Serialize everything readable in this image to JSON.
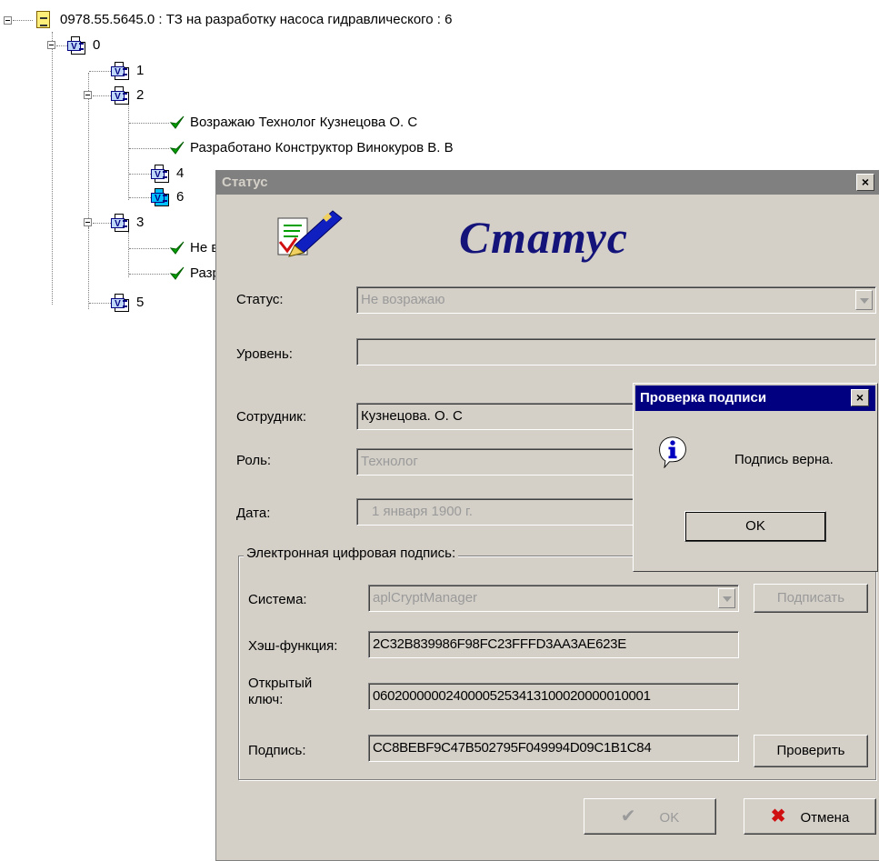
{
  "tree": {
    "root_label": "0978.55.5645.0 : ТЗ на разработку насоса гидравлического : 6",
    "nodes": [
      {
        "label": "0"
      },
      {
        "label": "1"
      },
      {
        "label": "2"
      },
      {
        "label": "Возражаю Технолог Кузнецова О. С"
      },
      {
        "label": "Разработано Конструктор Винокуров В. В"
      },
      {
        "label": "4"
      },
      {
        "label": "6"
      },
      {
        "label": "3"
      },
      {
        "label": "Не в"
      },
      {
        "label": "Разр"
      },
      {
        "label": "5"
      }
    ]
  },
  "status_window": {
    "title": "Статус",
    "heading": "Статус",
    "close": "×",
    "status_label": "Статус:",
    "status_value": "Не возражаю",
    "level_label": "Уровень:",
    "level_value": "",
    "employee_label": "Сотрудник:",
    "employee_value": "Кузнецова. О. С",
    "role_label": "Роль:",
    "role_value": "Технолог",
    "date_label": "Дата:",
    "date_value": "1  января  1900 г.",
    "eds_group_label": "Электронная цифровая подпись:",
    "system_label": "Система:",
    "system_value": "aplCryptManager",
    "sign_button": "Подписать",
    "hash_label": "Хэш-функция:",
    "hash_value": "2C32B839986F98FC23FFFD3AA3AE623E",
    "pubkey_label_1": "Открытый",
    "pubkey_label_2": "ключ:",
    "pubkey_value": "06020000002400005253413100020000010001",
    "signature_label": "Подпись:",
    "signature_value": "CC8BEBF9C47B502795F049994D09C1B1C84",
    "verify_button": "Проверить",
    "ok_button": "OK",
    "cancel_button": "Отмена"
  },
  "message_box": {
    "title": "Проверка подписи",
    "close": "×",
    "text": "Подпись верна.",
    "ok_button": "OK"
  },
  "colors": {
    "selected_node": "#00bfff",
    "check_green": "#00a000",
    "heading_blue": "#13137a",
    "msg_title_bar": "#000080",
    "inactive_title_bar": "#808080"
  }
}
